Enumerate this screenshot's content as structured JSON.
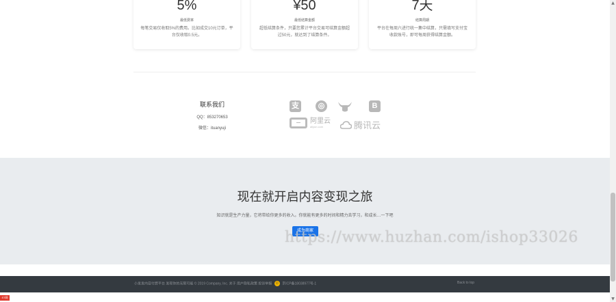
{
  "features": [
    {
      "value": "5%",
      "title": "最低费率",
      "desc": "每笔交易仅收取5%的费用。比如成交10元订单，平台仅收取0.5元。"
    },
    {
      "value": "¥50",
      "title": "最低结算金额",
      "desc": "超低结算条件，只要您累计平台交易可结算金额超过50元，就达到了结算条件。"
    },
    {
      "value": "7天",
      "title": "结算周期",
      "desc": "平台在每周六进行统一集中结算，只需填写支付宝收款账号，即可每周获得结算金额。"
    }
  ],
  "contact": {
    "title": "联系我们",
    "qq": "QQ：853270653",
    "wechat": "微信：ituanyuji"
  },
  "partners": {
    "alipay": "支",
    "wechat": "◎",
    "bilibili": "B",
    "aliyun_name": "阿里云",
    "aliyun_domain": "aliyun.com",
    "tencent": "腾讯云"
  },
  "cta": {
    "heading": "现在就开启内容变现之旅",
    "subtitle": "知识就是生产力量，它将带给你更多的收入。你就能有更多的时间和精力去学习，和成长…一下吧",
    "button": "成为商家"
  },
  "watermark": "https://www.huzhan.com/ishop33026",
  "footer": {
    "text": "小发发内容付费平台 发现你的无限可能 © 2019 Company, Inc. 关于 用户隐私政策 投诉举报",
    "icp": "京ICP备18038977号-1",
    "back_to_top": "Back to top"
  },
  "corner_badge": "ST网"
}
